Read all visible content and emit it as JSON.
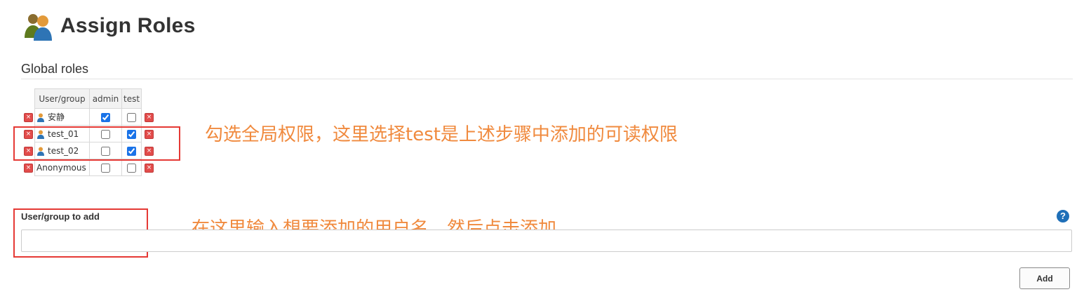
{
  "page": {
    "title": "Assign Roles",
    "icon": "users-group-icon"
  },
  "global_roles": {
    "section_title": "Global roles",
    "columns": [
      "User/group",
      "admin",
      "test"
    ],
    "rows": [
      {
        "user": "安静",
        "icon": "user-icon",
        "admin": true,
        "test": false
      },
      {
        "user": "test_01",
        "icon": "user-icon",
        "admin": false,
        "test": true
      },
      {
        "user": "test_02",
        "icon": "user-icon",
        "admin": false,
        "test": true
      },
      {
        "user": "Anonymous",
        "icon": null,
        "admin": false,
        "test": false
      }
    ],
    "delete_icon": "delete-icon",
    "delete_glyph": "×"
  },
  "annotations": {
    "note_roles": "勾选全局权限，这里选择test是上述步骤中添加的可读权限",
    "note_add": "在这里输入想要添加的用户名，然后点击添加"
  },
  "add_user": {
    "label": "User/group to add",
    "value": "",
    "placeholder": "",
    "help_icon": "help-icon",
    "help_glyph": "?",
    "button_label": "Add"
  },
  "colors": {
    "annotation_box": "#e53935",
    "annotation_text": "#f08a3e",
    "help": "#1e6fb8",
    "delete": "#e24c4b"
  }
}
